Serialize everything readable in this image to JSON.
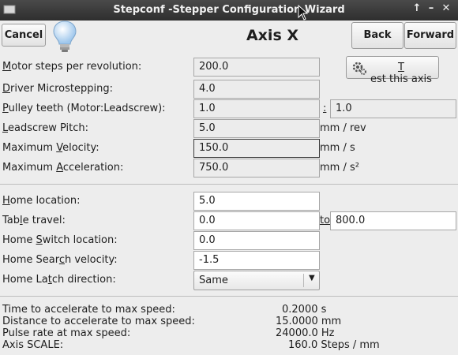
{
  "window": {
    "title": "Stepconf -Stepper Configuration Wizard",
    "controls": {
      "pin": "↑",
      "minimize": "–",
      "close": "✕"
    }
  },
  "toolbar": {
    "cancel_label": "Cancel",
    "back_label": "Back",
    "forward_label": "Forward",
    "page_title": "Axis X",
    "test_label_mnemonic": "T",
    "test_label_rest": "est this axis",
    "test_icon": "gear-icon",
    "hint_icon": "lightbulb-icon"
  },
  "motor": {
    "steps": {
      "mnemonic": "M",
      "rest": "otor steps per revolution:",
      "value": "200.0"
    },
    "microstep": {
      "mnemonic": "D",
      "rest": "river Microstepping:",
      "value": "4.0"
    },
    "pulley": {
      "mnemonic": "P",
      "rest": "ulley teeth (Motor:Leadscrew):",
      "value_motor": "1.0",
      "separator": ":",
      "value_leadscrew": "1.0"
    },
    "pitch": {
      "mnemonic": "L",
      "rest": "eadscrew Pitch:",
      "value": "5.0",
      "unit": "mm / rev"
    },
    "velocity": {
      "pre": "Maximum ",
      "mnemonic": "V",
      "rest": "elocity:",
      "value": "150.0",
      "unit": "mm / s"
    },
    "accel": {
      "pre": "Maximum ",
      "mnemonic": "A",
      "rest": "cceleration:",
      "value": "750.0",
      "unit": "mm / s²"
    }
  },
  "homing": {
    "location": {
      "mnemonic": "H",
      "rest": "ome location:",
      "value": "5.0"
    },
    "travel": {
      "pre": "Tab",
      "mnemonic": "l",
      "rest": "e travel:",
      "value_from": "0.0",
      "to_mnemonic": "to",
      "value_to": "800.0"
    },
    "switch": {
      "pre": "Home ",
      "mnemonic": "S",
      "rest": "witch location:",
      "value": "0.0"
    },
    "search": {
      "pre": "Home Sear",
      "mnemonic": "c",
      "rest": "h velocity:",
      "value": "-1.5"
    },
    "latch": {
      "pre": "Home La",
      "mnemonic": "t",
      "rest": "ch direction:",
      "value": "Same"
    }
  },
  "summary": [
    {
      "label": "Time to accelerate to max speed:",
      "value": "0.2000 s"
    },
    {
      "label": "Distance to accelerate to max speed:",
      "value": "15.0000 mm"
    },
    {
      "label": "Pulse rate at max speed:",
      "value": "24000.0 Hz"
    },
    {
      "label": "Axis SCALE:",
      "value": "160.0 Steps / mm"
    }
  ]
}
